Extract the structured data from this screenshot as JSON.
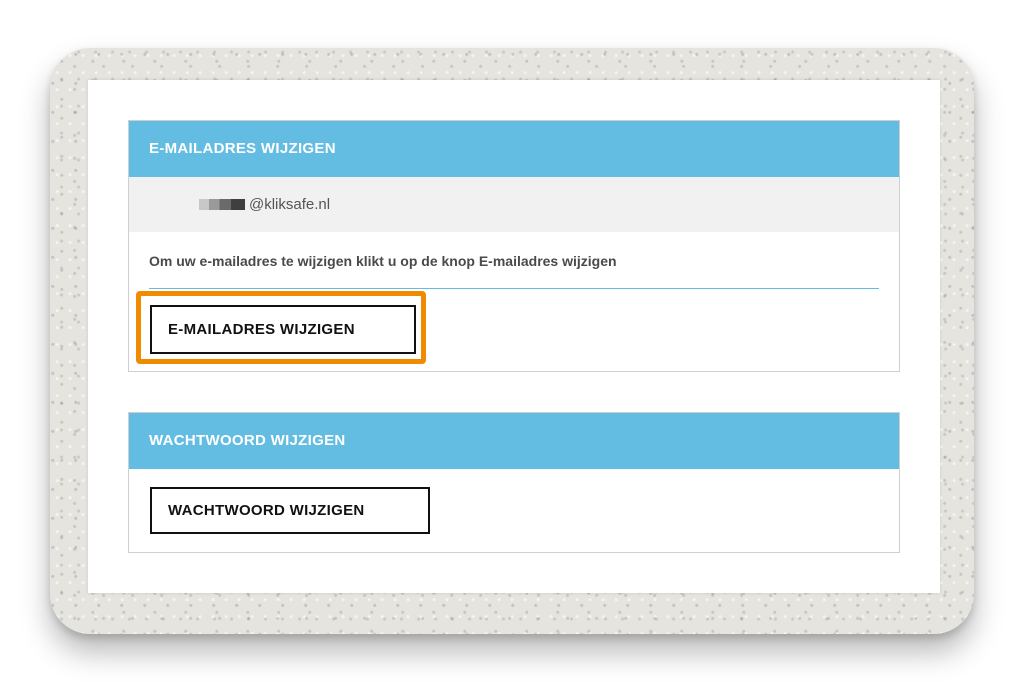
{
  "email_section": {
    "title": "E-MAILADRES WIJZIGEN",
    "email_suffix": "@kliksafe.nl",
    "instruction": "Om uw e-mailadres te wijzigen klikt u op de knop E-mailadres wijzigen",
    "button_label": "E-MAILADRES WIJZIGEN"
  },
  "password_section": {
    "title": "WACHTWOORD WIJZIGEN",
    "button_label": "WACHTWOORD WIJZIGEN"
  },
  "colors": {
    "header_blue": "#63bde3",
    "highlight_orange": "#f08a00"
  }
}
